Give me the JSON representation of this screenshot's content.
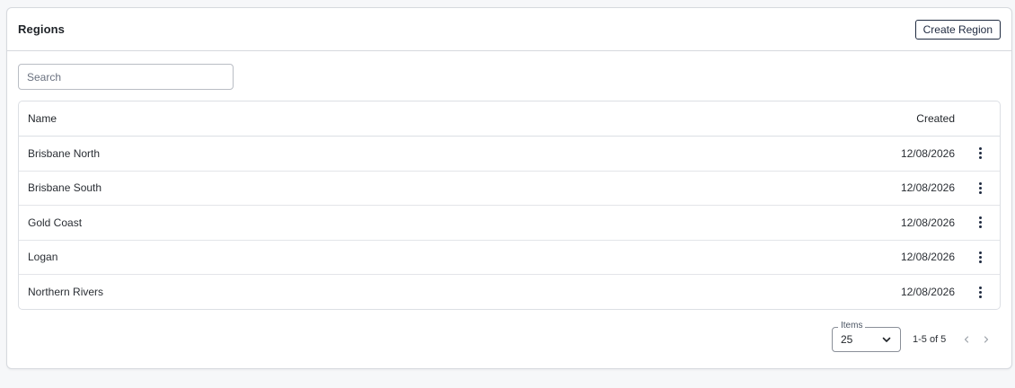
{
  "header": {
    "title": "Regions",
    "create_label": "Create Region"
  },
  "search": {
    "placeholder": "Search",
    "value": ""
  },
  "table": {
    "columns": [
      "Name",
      "Created"
    ],
    "rows": [
      {
        "name": "Brisbane North",
        "created": "12/08/2026"
      },
      {
        "name": "Brisbane South",
        "created": "12/08/2026"
      },
      {
        "name": "Gold Coast",
        "created": "12/08/2026"
      },
      {
        "name": "Logan",
        "created": "12/08/2026"
      },
      {
        "name": "Northern Rivers",
        "created": "12/08/2026"
      }
    ]
  },
  "pagination": {
    "items_label": "Items",
    "items_value": "25",
    "range": "1-5 of 5"
  },
  "icons": {
    "row_action": "more-vertical-icon",
    "select": "chevron-down-icon",
    "prev": "chevron-left-icon",
    "next": "chevron-right-icon"
  },
  "colors": {
    "accent": "#1f2a40",
    "border": "#d6d9de",
    "background": "#f6f7f9"
  }
}
